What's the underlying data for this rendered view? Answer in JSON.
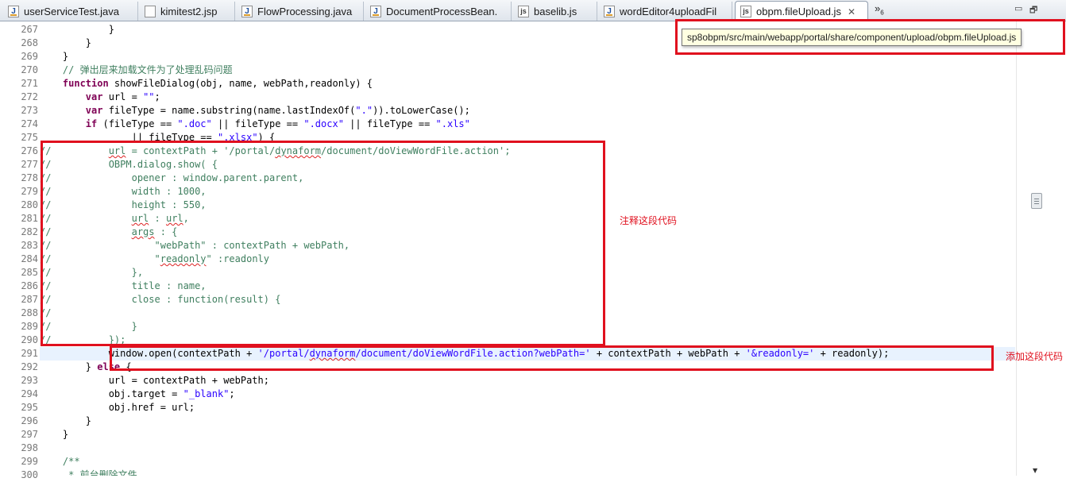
{
  "tabs": [
    {
      "label": "userServiceTest.java",
      "icon": "java-file-icon",
      "active": false
    },
    {
      "label": "kimitest2.jsp",
      "icon": "jsp-file-icon",
      "active": false
    },
    {
      "label": "FlowProcessing.java",
      "icon": "java-file-icon",
      "active": false
    },
    {
      "label": "DocumentProcessBean.",
      "icon": "java-file-icon",
      "active": false
    },
    {
      "label": "baselib.js",
      "icon": "js-file-icon",
      "active": false
    },
    {
      "label": "wordEditor4uploadFil",
      "icon": "java-file-icon",
      "active": false
    },
    {
      "label": "obpm.fileUpload.js",
      "icon": "js-file-icon",
      "active": true,
      "close": "✕"
    }
  ],
  "overflow": {
    "label": "»",
    "count": "6"
  },
  "window_buttons": {
    "minimize": "▭",
    "maximize": "🗗"
  },
  "tooltip": {
    "path": "sp8obpm/src/main/webapp/portal/share/component/upload/obpm.fileUpload.js"
  },
  "annotations": {
    "comment_label": "注释这段代码",
    "add_label": "添加这段代码"
  },
  "colors": {
    "keyword": "#7f0055",
    "string": "#2a00ff",
    "comment": "#3f7f5f",
    "annotation": "#e0101e",
    "current_line": "#e8f2fe"
  },
  "code": {
    "current_line": "291",
    "lines": [
      {
        "n": "267",
        "t": "            }"
      },
      {
        "n": "268",
        "t": "        }"
      },
      {
        "n": "269",
        "t": "    }"
      },
      {
        "n": "270",
        "t": "    // 弹出层来加载文件为了处理乱码问题"
      },
      {
        "n": "271",
        "t": "    function showFileDialog(obj, name, webPath,readonly) {"
      },
      {
        "n": "272",
        "t": "        var url = \"\";"
      },
      {
        "n": "273",
        "t": "        var fileType = name.substring(name.lastIndexOf(\".\")).toLowerCase();"
      },
      {
        "n": "274",
        "t": "        if (fileType == \".doc\" || fileType == \".docx\" || fileType == \".xls\""
      },
      {
        "n": "275",
        "t": "                || fileType == \".xlsx\") {"
      },
      {
        "n": "276",
        "t": "//          url = contextPath + '/portal/dynaform/document/doViewWordFile.action';"
      },
      {
        "n": "277",
        "t": "//          OBPM.dialog.show( {"
      },
      {
        "n": "278",
        "t": "//              opener : window.parent.parent,"
      },
      {
        "n": "279",
        "t": "//              width : 1000,"
      },
      {
        "n": "280",
        "t": "//              height : 550,"
      },
      {
        "n": "281",
        "t": "//              url : url,"
      },
      {
        "n": "282",
        "t": "//              args : {"
      },
      {
        "n": "283",
        "t": "//                  \"webPath\" : contextPath + webPath,"
      },
      {
        "n": "284",
        "t": "//                  \"readonly\" :readonly"
      },
      {
        "n": "285",
        "t": "//              },"
      },
      {
        "n": "286",
        "t": "//              title : name,"
      },
      {
        "n": "287",
        "t": "//              close : function(result) {"
      },
      {
        "n": "288",
        "t": "//"
      },
      {
        "n": "289",
        "t": "//              }"
      },
      {
        "n": "290",
        "t": "//          });"
      },
      {
        "n": "291",
        "t": "            window.open(contextPath + '/portal/dynaform/document/doViewWordFile.action?webPath=' + contextPath + webPath + '&readonly=' + readonly);"
      },
      {
        "n": "292",
        "t": "        } else {"
      },
      {
        "n": "293",
        "t": "            url = contextPath + webPath;"
      },
      {
        "n": "294",
        "t": "            obj.target = \"_blank\";"
      },
      {
        "n": "295",
        "t": "            obj.href = url;"
      },
      {
        "n": "296",
        "t": "        }"
      },
      {
        "n": "297",
        "t": "    }"
      },
      {
        "n": "298",
        "t": ""
      },
      {
        "n": "299",
        "t": "    /**"
      },
      {
        "n": "300",
        "t": "     * 前台删除文件"
      }
    ]
  }
}
